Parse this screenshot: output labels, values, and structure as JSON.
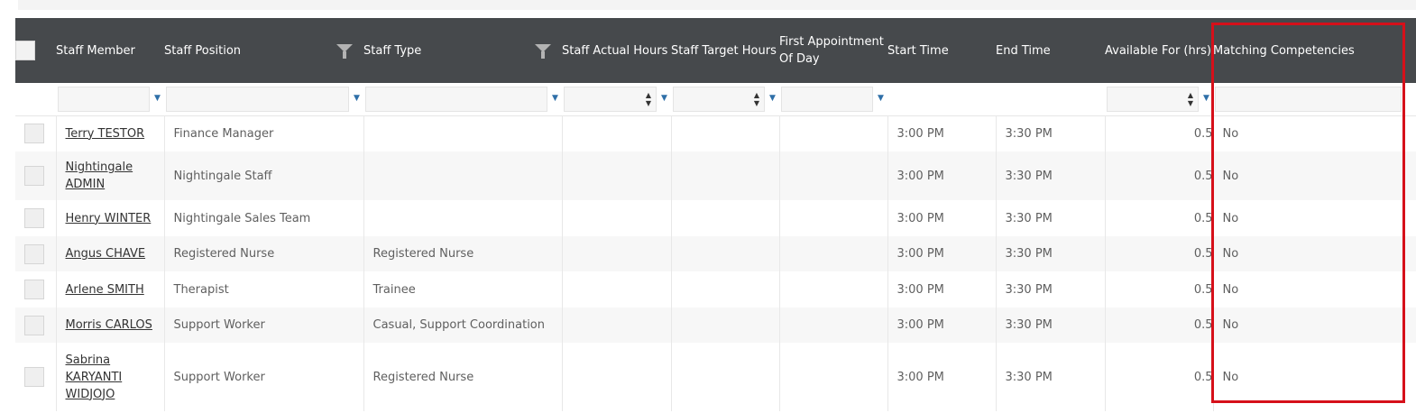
{
  "highlight_color": "#d6101a",
  "columns": [
    {
      "label": "",
      "filterable": false
    },
    {
      "label": "Staff Member",
      "filterable": false
    },
    {
      "label": "Staff Position",
      "filterable": true
    },
    {
      "label": "Staff Type",
      "filterable": true
    },
    {
      "label": "Staff Actual Hours",
      "filterable": false
    },
    {
      "label": "Staff Target Hours",
      "filterable": false
    },
    {
      "label": "First Appointment Of Day",
      "filterable": false
    },
    {
      "label": "Start Time",
      "filterable": false
    },
    {
      "label": "End Time",
      "filterable": false
    },
    {
      "label": "Available For (hrs)",
      "filterable": false
    },
    {
      "label": "Matching Competencies",
      "filterable": false
    }
  ],
  "rows": [
    {
      "member": "Terry TESTOR",
      "position": "Finance Manager",
      "type": "",
      "actual": "",
      "target": "",
      "first": "",
      "start": "3:00 PM",
      "end": "3:30 PM",
      "available": "0.5",
      "matching": "No"
    },
    {
      "member": "Nightingale ADMIN",
      "position": "Nightingale Staff",
      "type": "",
      "actual": "",
      "target": "",
      "first": "",
      "start": "3:00 PM",
      "end": "3:30 PM",
      "available": "0.5",
      "matching": "No"
    },
    {
      "member": "Henry WINTER",
      "position": "Nightingale Sales Team",
      "type": "",
      "actual": "",
      "target": "",
      "first": "",
      "start": "3:00 PM",
      "end": "3:30 PM",
      "available": "0.5",
      "matching": "No"
    },
    {
      "member": "Angus CHAVE",
      "position": "Registered Nurse",
      "type": "Registered Nurse",
      "actual": "",
      "target": "",
      "first": "",
      "start": "3:00 PM",
      "end": "3:30 PM",
      "available": "0.5",
      "matching": "No"
    },
    {
      "member": "Arlene SMITH",
      "position": "Therapist",
      "type": "Trainee",
      "actual": "",
      "target": "",
      "first": "",
      "start": "3:00 PM",
      "end": "3:30 PM",
      "available": "0.5",
      "matching": "No"
    },
    {
      "member": "Morris CARLOS",
      "position": "Support Worker",
      "type": "Casual, Support Coordination",
      "actual": "",
      "target": "",
      "first": "",
      "start": "3:00 PM",
      "end": "3:30 PM",
      "available": "0.5",
      "matching": "No"
    },
    {
      "member": "Sabrina KARYANTI WIDJOJO",
      "position": "Support Worker",
      "type": "Registered Nurse",
      "actual": "",
      "target": "",
      "first": "",
      "start": "3:00 PM",
      "end": "3:30 PM",
      "available": "0.5",
      "matching": "No"
    }
  ]
}
